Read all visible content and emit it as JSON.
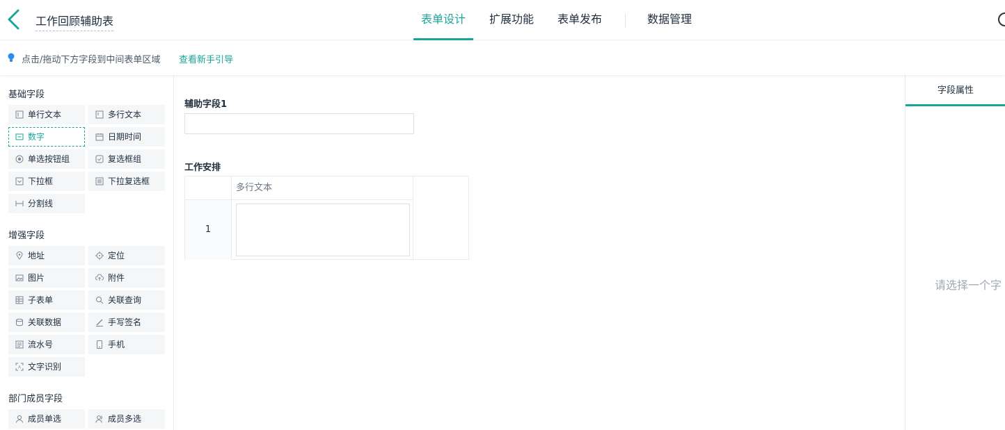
{
  "header": {
    "form_title": "工作回顾辅助表",
    "tabs": [
      {
        "label": "表单设计",
        "active": true
      },
      {
        "label": "扩展功能"
      },
      {
        "label": "表单发布"
      },
      {
        "label": "数据管理"
      }
    ]
  },
  "tip": {
    "text": "点击/拖动下方字段到中间表单区域",
    "link": "查看新手引导"
  },
  "palette": {
    "basic": {
      "title": "基础字段",
      "items": [
        "单行文本",
        "多行文本",
        "数字",
        "日期时间",
        "单选按钮组",
        "复选框组",
        "下拉框",
        "下拉复选框",
        "分割线"
      ]
    },
    "advanced": {
      "title": "增强字段",
      "items": [
        "地址",
        "定位",
        "图片",
        "附件",
        "子表单",
        "关联查询",
        "关联数据",
        "手写签名",
        "流水号",
        "手机",
        "文字识别"
      ]
    },
    "members": {
      "title": "部门成员字段",
      "items": [
        "成员单选",
        "成员多选"
      ]
    }
  },
  "canvas": {
    "field1_label": "辅助字段1",
    "field2_label": "工作安排",
    "subtable": {
      "column": "多行文本",
      "row_index": "1"
    }
  },
  "properties": {
    "tab": "字段属性",
    "empty": "请选择一个字"
  },
  "colors": {
    "accent": "#1aa59a"
  }
}
